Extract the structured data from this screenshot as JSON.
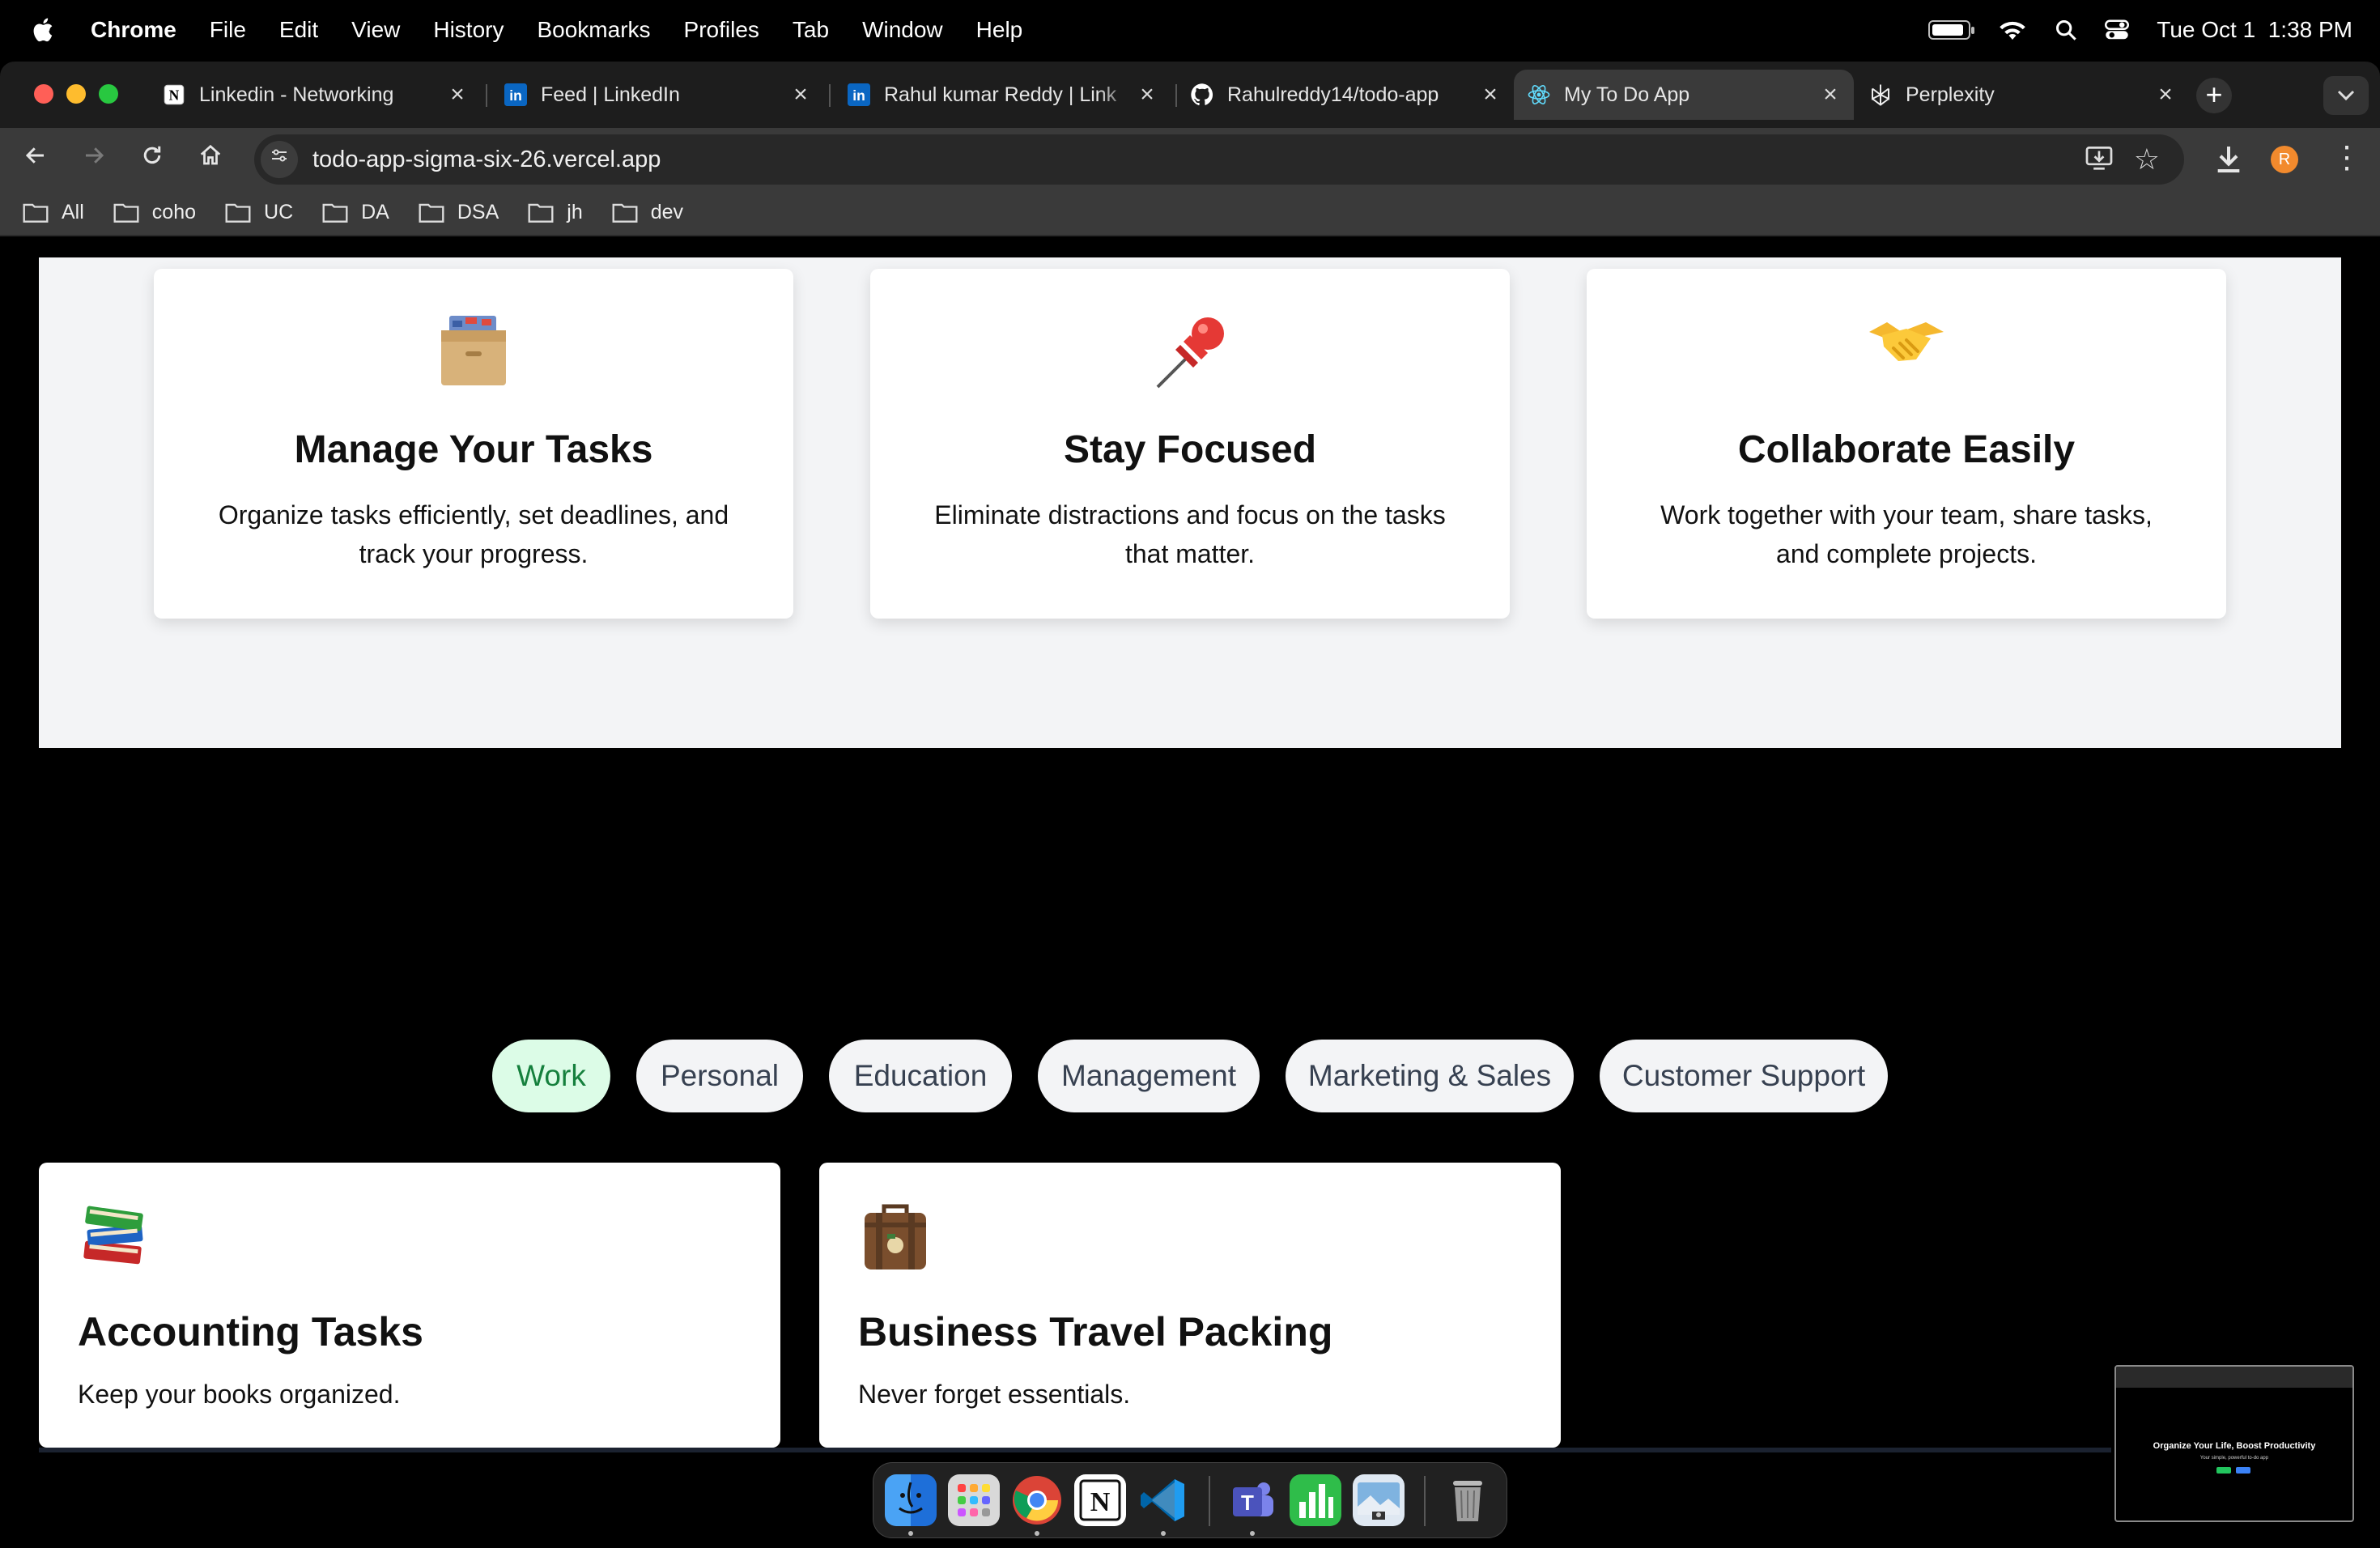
{
  "menubar": {
    "app_name": "Chrome",
    "items": [
      "File",
      "Edit",
      "View",
      "History",
      "Bookmarks",
      "Profiles",
      "Tab",
      "Window",
      "Help"
    ],
    "datetime": "Tue Oct 1  1:38 PM",
    "battery_level": 0.85
  },
  "tabs": [
    {
      "title": "Linkedin - Networking",
      "favicon": "notion-icon",
      "active": false
    },
    {
      "title": "Feed | LinkedIn",
      "favicon": "linkedin-icon",
      "active": false
    },
    {
      "title": "Rahul kumar Reddy | Link",
      "favicon": "linkedin-icon",
      "active": false
    },
    {
      "title": "Rahulreddy14/todo-app",
      "favicon": "github-icon",
      "active": false
    },
    {
      "title": "My To Do App",
      "favicon": "react-icon",
      "active": true
    },
    {
      "title": "Perplexity",
      "favicon": "perplexity-icon",
      "active": false
    }
  ],
  "toolbar": {
    "url": "todo-app-sigma-six-26.vercel.app",
    "profile_initial": "R"
  },
  "bookmarks": [
    "All",
    "coho",
    "UC",
    "DA",
    "DSA",
    "jh",
    "dev"
  ],
  "features": [
    {
      "icon": "card-file-box-icon",
      "title": "Manage Your Tasks",
      "description": "Organize tasks efficiently, set deadlines, and track your progress."
    },
    {
      "icon": "pushpin-icon",
      "title": "Stay Focused",
      "description": "Eliminate distractions and focus on the tasks that matter."
    },
    {
      "icon": "handshake-icon",
      "title": "Collaborate Easily",
      "description": "Work together with your team, share tasks, and complete projects."
    }
  ],
  "categories": [
    {
      "label": "Work",
      "active": true
    },
    {
      "label": "Personal",
      "active": false
    },
    {
      "label": "Education",
      "active": false
    },
    {
      "label": "Management",
      "active": false
    },
    {
      "label": "Marketing & Sales",
      "active": false
    },
    {
      "label": "Customer Support",
      "active": false
    }
  ],
  "task_cards": [
    {
      "icon": "books-icon",
      "title": "Accounting Tasks",
      "description": "Keep your books organized."
    },
    {
      "icon": "luggage-icon",
      "title": "Business Travel Packing",
      "description": "Never forget essentials."
    }
  ],
  "preview_thumbnail": {
    "title": "Organize Your Life, Boost Productivity",
    "subtitle": "Your simple, powerful to-do app"
  },
  "colors": {
    "page_section_bg": "#f3f4f6",
    "chip_active_bg": "#dcfce7",
    "chip_active_text": "#15803d",
    "profile_avatar": "#f28a2d"
  }
}
